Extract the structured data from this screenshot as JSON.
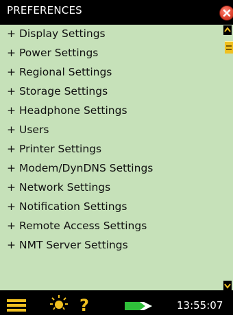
{
  "header": {
    "title": "PREFERENCES"
  },
  "menu": {
    "expand_symbol": "+",
    "items": [
      {
        "label": "Display Settings"
      },
      {
        "label": "Power Settings"
      },
      {
        "label": "Regional Settings"
      },
      {
        "label": "Storage Settings"
      },
      {
        "label": "Headphone Settings"
      },
      {
        "label": "Users"
      },
      {
        "label": "Printer Settings"
      },
      {
        "label": "Modem/DynDNS Settings"
      },
      {
        "label": "Network Settings"
      },
      {
        "label": "Notification Settings"
      },
      {
        "label": "Remote Access Settings"
      },
      {
        "label": "NMT Server Settings"
      }
    ]
  },
  "statusbar": {
    "menu_icon": "hamburger-menu-icon",
    "backlight_icon": "sun-icon",
    "help_label": "?",
    "battery_icon": "battery-icon",
    "time": "13:55:07"
  },
  "colors": {
    "background": "#c6e1b9",
    "accent": "#f0c020",
    "close": "#e0442e",
    "battery": "#2fbf3a"
  }
}
